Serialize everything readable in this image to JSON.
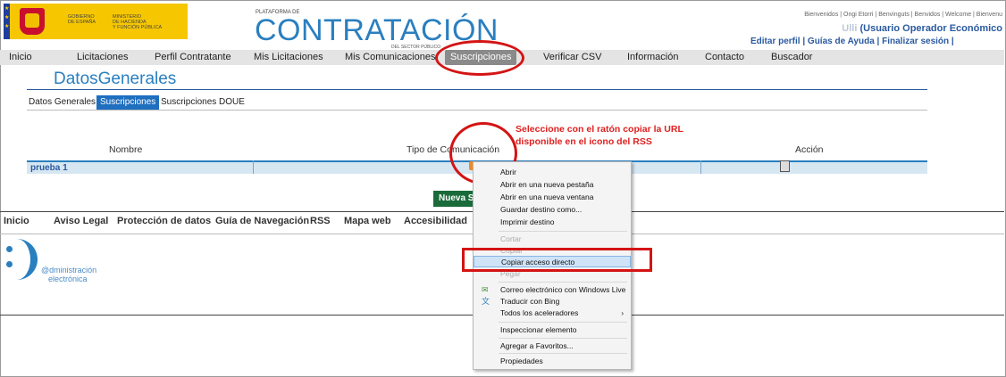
{
  "header": {
    "gov_text_1": "GOBIERNO\nDE ESPAÑA",
    "gov_text_2": "MINISTERIO\nDE HACIENDA\nY FUNCIÓN PÚBLICA",
    "platform_small": "PLATAFORMA DE",
    "platform_title": "CONTRATACIÓN",
    "platform_sub": "DEL SECTOR PÚBLICO",
    "welcome": "Bienvenidos | Ongi Etorri | Benvinguts | Benvidos | Welcome | Bienvenu",
    "user_name_blur": "Ulli",
    "user_role": "(Usuario Operador Económico",
    "account_links": "Editar perfil | Guías de Ayuda | Finalizar sesión |"
  },
  "nav": {
    "items": [
      "Inicio",
      "Licitaciones",
      "Perfil Contratante",
      "Mis Licitaciones",
      "Mis Comunicaciones",
      "Suscripciones",
      "Verificar CSV",
      "Información",
      "Contacto",
      "Buscador"
    ],
    "active": "Suscripciones"
  },
  "page": {
    "title": "DatosGenerales",
    "subtabs": [
      "Datos Generales",
      "Suscripciones",
      "Suscripciones DOUE"
    ],
    "active_subtab": "Suscripciones"
  },
  "annotation": {
    "line1": "Seleccione con el ratón copiar la URL",
    "line2": "disponible en el icono del RSS"
  },
  "table": {
    "headers": [
      "Nombre",
      "Tipo de Comunicación",
      "Acción"
    ],
    "rows": [
      {
        "name": "prueba 1"
      }
    ]
  },
  "new_button_label": "Nueva Suscripción",
  "footer": {
    "links": [
      "Inicio",
      "Aviso Legal",
      "Protección de datos",
      "Guía de Navegación",
      "RSS",
      "Mapa web",
      "Accesibilidad"
    ],
    "logo_line1": "@dministración",
    "logo_line2": "electrónica"
  },
  "context_menu": {
    "items": [
      {
        "label": "Abrir",
        "disabled": false
      },
      {
        "label": "Abrir en una nueva pestaña",
        "disabled": false
      },
      {
        "label": "Abrir en una nueva ventana",
        "disabled": false
      },
      {
        "label": "Guardar destino como...",
        "disabled": false
      },
      {
        "label": "Imprimir destino",
        "disabled": false
      },
      {
        "label": "Cortar",
        "disabled": true
      },
      {
        "label": "Copiar",
        "disabled": true
      },
      {
        "label": "Copiar acceso directo",
        "disabled": false,
        "highlighted": true
      },
      {
        "label": "Pegar",
        "disabled": true
      },
      {
        "label": "Correo electrónico con Windows Live",
        "disabled": false,
        "icon": "windows-live-icon"
      },
      {
        "label": "Traducir con Bing",
        "disabled": false,
        "icon": "bing-translate-icon"
      },
      {
        "label": "Todos los aceleradores",
        "disabled": false,
        "submenu": true
      },
      {
        "label": "Inspeccionar elemento",
        "disabled": false
      },
      {
        "label": "Agregar a Favoritos...",
        "disabled": false
      },
      {
        "label": "Propiedades",
        "disabled": false
      }
    ]
  },
  "colors": {
    "brand_blue": "#2a7fbf",
    "annotation_red": "#d41414",
    "button_green": "#1a6b3a",
    "gov_yellow": "#f6c700"
  }
}
